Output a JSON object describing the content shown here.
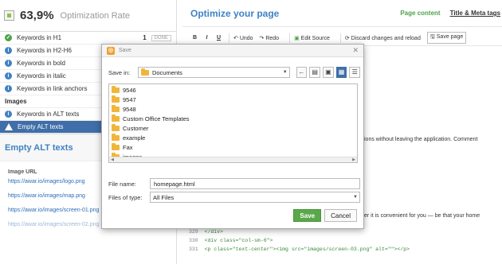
{
  "left": {
    "score": "63,9%",
    "score_label": "Optimization Rate",
    "checks": [
      {
        "label": "Keywords in H1",
        "status": "ok",
        "count": "1",
        "done": "DONE"
      },
      {
        "label": "Keywords in H2-H6",
        "status": "info"
      },
      {
        "label": "Keywords in bold",
        "status": "info"
      },
      {
        "label": "Keywords in italic",
        "status": "info"
      },
      {
        "label": "Keywords in link anchors",
        "status": "info"
      }
    ],
    "section_images": "Images",
    "image_checks": [
      {
        "label": "Keywords in ALT texts",
        "status": "info"
      },
      {
        "label": "Empty ALT texts",
        "status": "warn"
      }
    ],
    "empty_alt_title": "Empty ALT texts",
    "image_url_header": "Image URL",
    "urls": [
      "https://awar.io/images/logo.png",
      "https://awar.io/images/map.png",
      "https://awar.io/images/screen-01.png",
      "https://awar.io/images/screen-02.png"
    ]
  },
  "right": {
    "title": "Optimize your page",
    "tab_content": "Page content",
    "tab_meta": "Title & Meta tags",
    "toolbar": {
      "bold": "B",
      "italic": "I",
      "underline": "U",
      "undo": "Undo",
      "redo": "Redo",
      "edit_source": "Edit Source",
      "discard": "Discard changes and reload",
      "save_page": "Save page"
    },
    "line1": "ions without leaving the application. Comment",
    "line2": "er it is convenient for you — be that your home",
    "code": [
      {
        "num": "329",
        "text": "</div>"
      },
      {
        "num": "330",
        "text": "<div class=\"col-sm-6\">"
      },
      {
        "num": "331",
        "text": "<p class=\"text-center\"><img src=\"images/screen-03.png\" alt=\"\"></p>"
      }
    ]
  },
  "dialog": {
    "title": "Save",
    "save_in_label": "Save in:",
    "save_in_value": "Documents",
    "folders": [
      "9546",
      "9547",
      "9548",
      "Custom Office Templates",
      "Customer",
      "example",
      "Fax",
      "images"
    ],
    "file_name_label": "File name:",
    "file_name_value": "homepage.html",
    "files_type_label": "Files of type:",
    "files_type_value": "All Files",
    "save_btn": "Save",
    "cancel_btn": "Cancel"
  }
}
